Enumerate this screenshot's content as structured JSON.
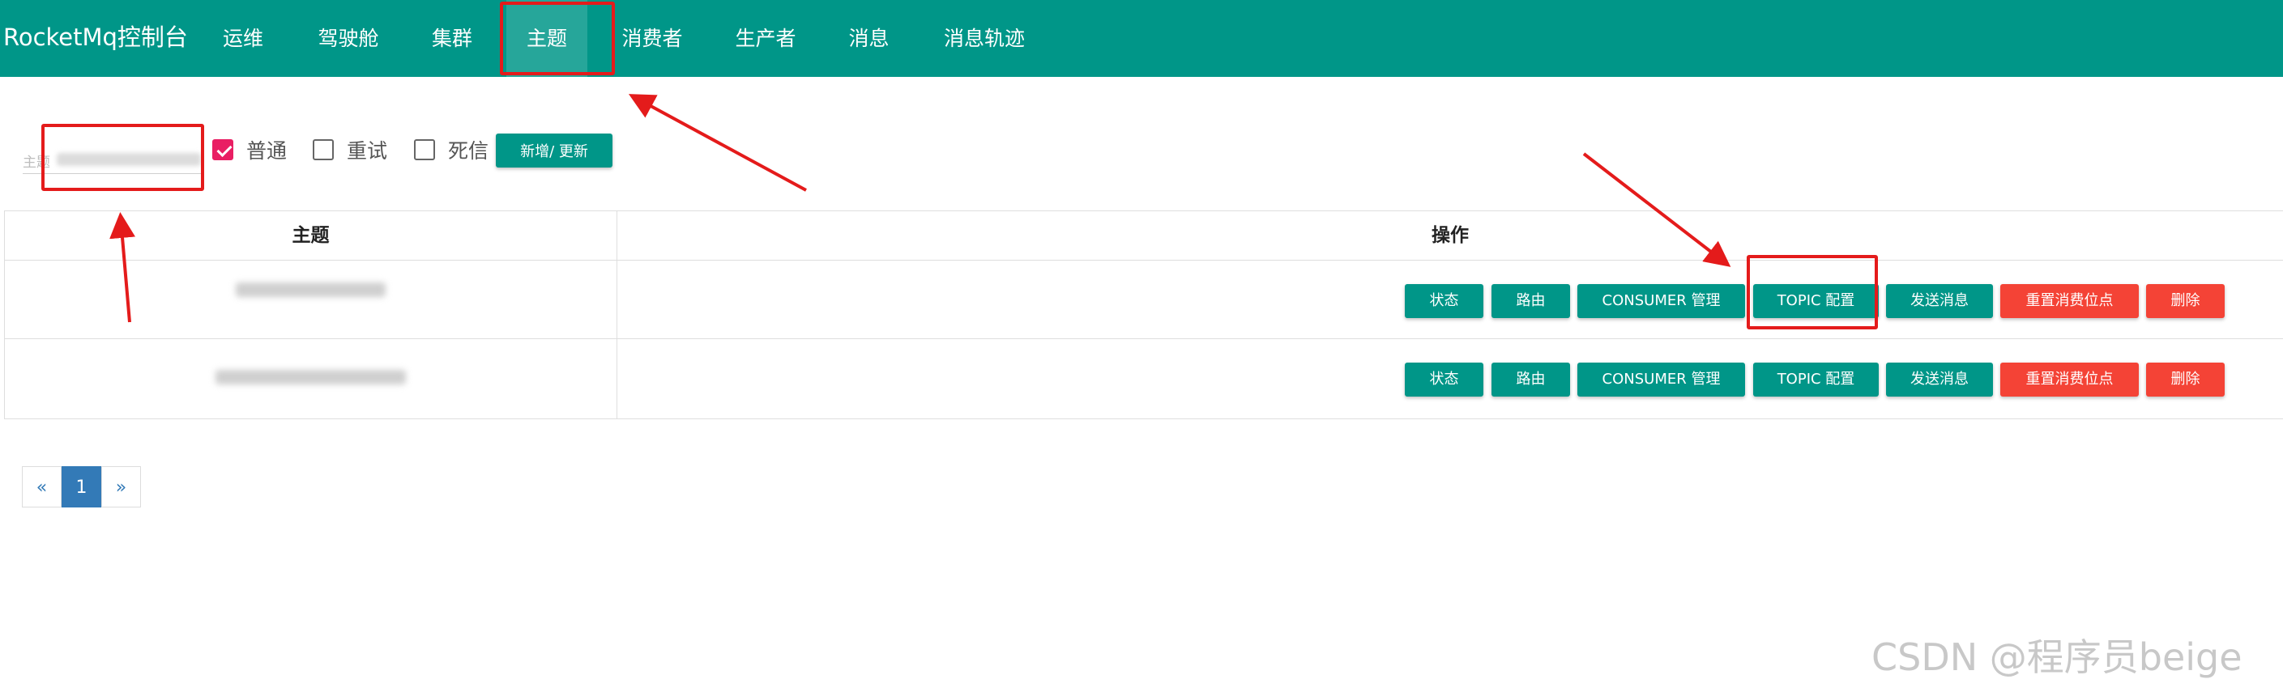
{
  "navbar": {
    "brand": "RocketMq控制台",
    "items": [
      {
        "label": "运维"
      },
      {
        "label": "驾驶舱"
      },
      {
        "label": "集群"
      },
      {
        "label": "主题"
      },
      {
        "label": "消费者"
      },
      {
        "label": "生产者"
      },
      {
        "label": "消息"
      },
      {
        "label": "消息轨迹"
      }
    ],
    "active_item": "主题"
  },
  "filter": {
    "topic_label": "主题",
    "checkboxes": [
      {
        "label": "普通",
        "checked": true
      },
      {
        "label": "重试",
        "checked": false
      },
      {
        "label": "死信",
        "checked": false
      }
    ],
    "add_update_label": "新增/ 更新"
  },
  "table": {
    "headers": {
      "topic": "主题",
      "operation": "操作"
    },
    "actions": [
      "状态",
      "路由",
      "CONSUMER 管理",
      "TOPIC 配置",
      "发送消息",
      "重置消费位点",
      "删除"
    ]
  },
  "pagination": {
    "prev": "«",
    "current": "1",
    "next": "»"
  },
  "watermark": "CSDN @程序员beige",
  "colors": {
    "navbar": "#009688",
    "active_nav": "#26a69a",
    "primary_button": "#009688",
    "danger_button": "#f44336",
    "checkbox_checked": "#e91e63",
    "pagination_active": "#337ab7",
    "annotation": "#e41b1b"
  }
}
